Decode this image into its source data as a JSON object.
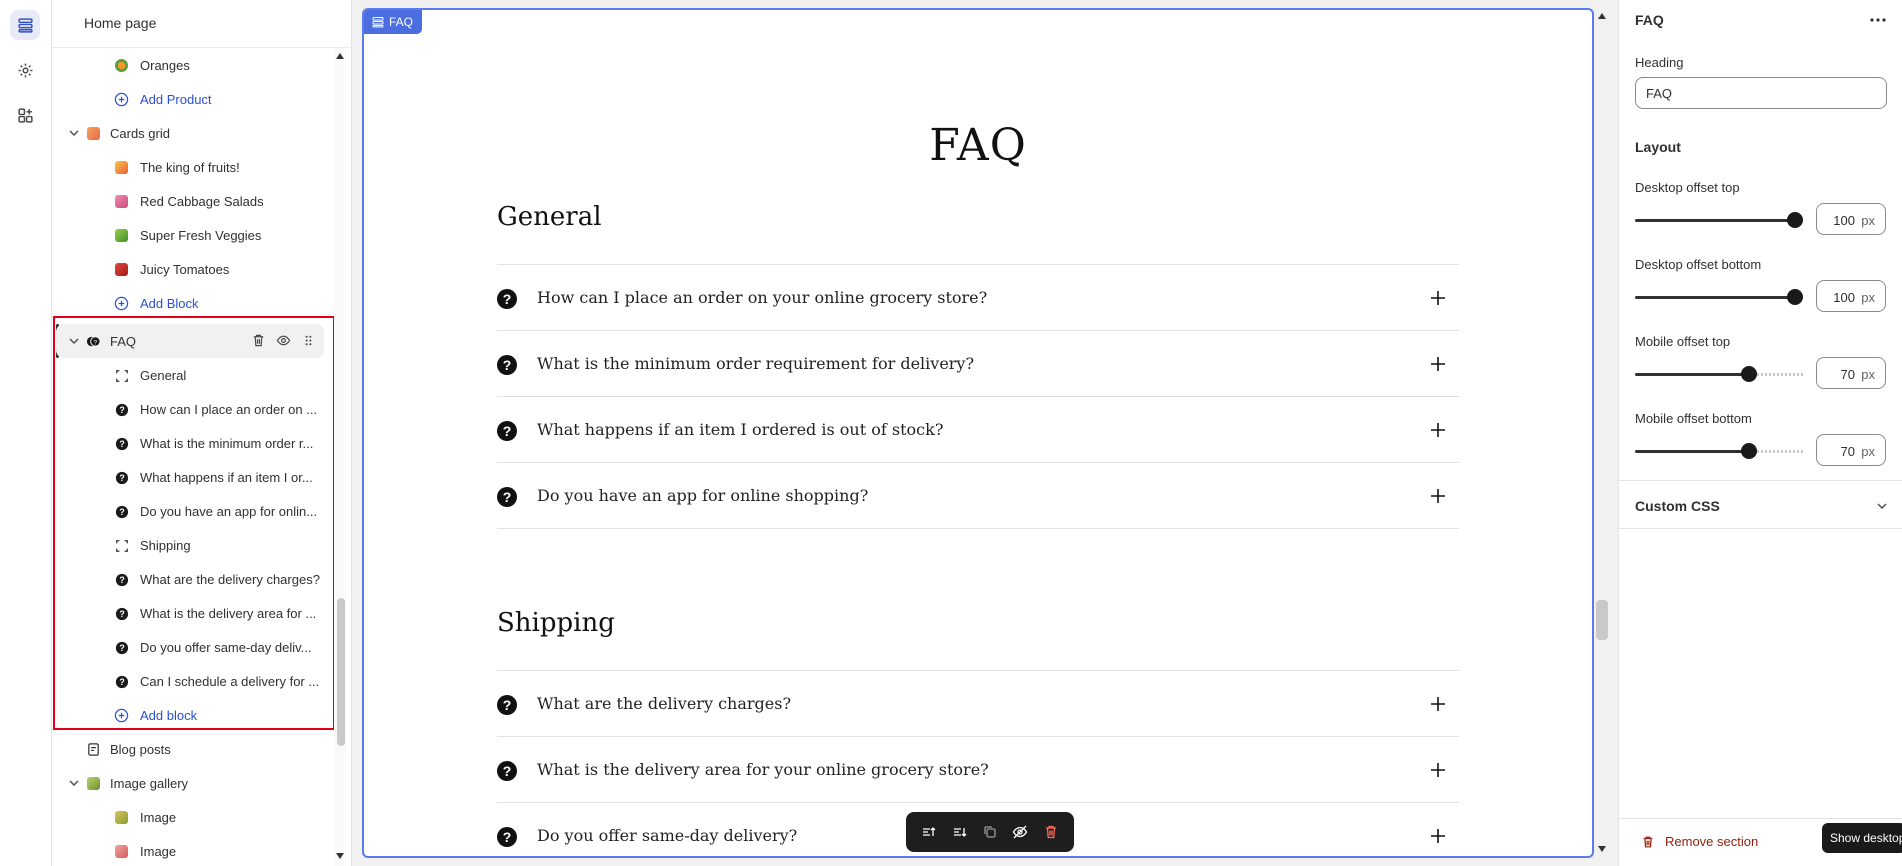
{
  "sidebar": {
    "title": "Home page",
    "rows": {
      "oranges": "Oranges",
      "add_product": "Add Product",
      "cards_grid": "Cards grid",
      "king_fruits": "The king of fruits!",
      "red_cabbage": "Red Cabbage Salads",
      "super_fresh": "Super Fresh Veggies",
      "juicy_tomatoes": "Juicy Tomatoes",
      "add_block": "Add Block",
      "faq": "FAQ",
      "general": "General",
      "q1": "How can I place an order on ...",
      "q2": "What is the minimum order r...",
      "q3": "What happens if an item I or...",
      "q4": "Do you have an app for onlin...",
      "shipping": "Shipping",
      "q5": "What are the delivery charges?",
      "q6": "What is the delivery area for ...",
      "q7": "Do you offer same-day deliv...",
      "q8": "Can I schedule a delivery for ...",
      "add_block_faq": "Add block",
      "blog_posts": "Blog posts",
      "image_gallery": "Image gallery",
      "image1": "Image",
      "image2": "Image"
    }
  },
  "preview": {
    "section_tag": "FAQ",
    "heading": "FAQ",
    "groups": [
      {
        "title": "General",
        "questions": [
          "How can I place an order on your online grocery store?",
          "What is the minimum order requirement for delivery?",
          "What happens if an item I ordered is out of stock?",
          "Do you have an app for online shopping?"
        ]
      },
      {
        "title": "Shipping",
        "questions": [
          "What are the delivery charges?",
          "What is the delivery area for your online grocery store?",
          "Do you offer same-day delivery?"
        ]
      }
    ]
  },
  "settings": {
    "title": "FAQ",
    "heading_label": "Heading",
    "heading_value": "FAQ",
    "layout_label": "Layout",
    "desktop_top_label": "Desktop offset top",
    "desktop_top_value": "100",
    "desktop_top_fraction": 1.0,
    "desktop_bottom_label": "Desktop offset bottom",
    "desktop_bottom_value": "100",
    "desktop_bottom_fraction": 1.0,
    "mobile_top_label": "Mobile offset top",
    "mobile_top_value": "70",
    "mobile_top_fraction": 0.7,
    "mobile_bottom_label": "Mobile offset bottom",
    "mobile_bottom_value": "70",
    "mobile_bottom_fraction": 0.7,
    "unit": "px",
    "custom_css_label": "Custom CSS",
    "remove_label": "Remove section",
    "tooltip": "Show desktop"
  },
  "colors": {
    "accent": "#4a6ee0",
    "link": "#2a50d4",
    "highlight_frame": "#e0001a",
    "danger": "#8e1f0b"
  }
}
